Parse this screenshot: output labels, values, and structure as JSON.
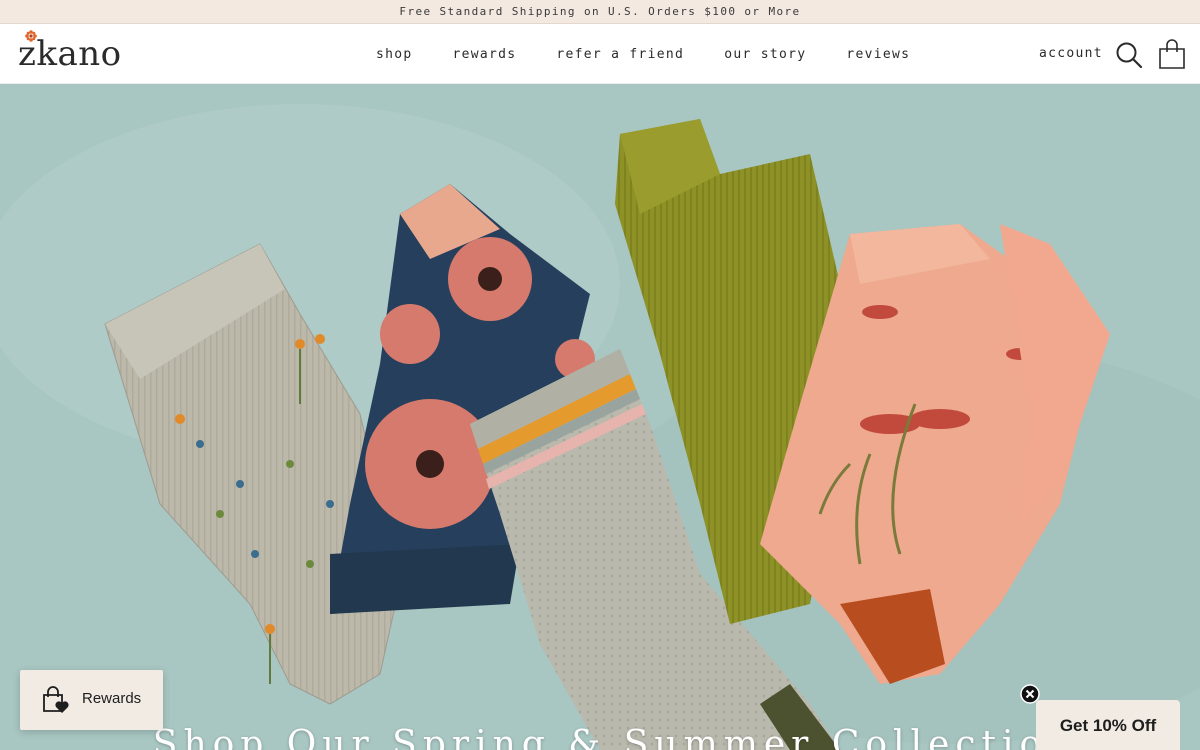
{
  "announcement": {
    "text": "Free Standard Shipping on U.S. Orders $100 or More"
  },
  "header": {
    "logo_text": "zkano",
    "nav": [
      {
        "label": "shop"
      },
      {
        "label": "rewards"
      },
      {
        "label": "refer a friend"
      },
      {
        "label": "our story"
      },
      {
        "label": "reviews"
      }
    ],
    "account_label": "account",
    "icons": [
      "search-icon",
      "cart-icon"
    ]
  },
  "hero": {
    "heading": "Shop Our Spring & Summer Collectio",
    "image_description_colors": {
      "background": "#a9c7c3",
      "sock_1": "#b9b6a8",
      "sock_2": "#263f5c",
      "sock_3": "#b7b7ab",
      "sock_4": "#8c8f24",
      "sock_5": "#eea98e"
    }
  },
  "rewards_widget": {
    "label": "Rewards",
    "icon": "shopping-bag-heart-icon"
  },
  "discount_widget": {
    "label": "Get 10% Off",
    "close_icon": "close-icon"
  },
  "colors": {
    "announcement_bg": "#f3e9e1",
    "widget_bg": "#f1ebe4",
    "logo_accent": "#e0662b"
  }
}
